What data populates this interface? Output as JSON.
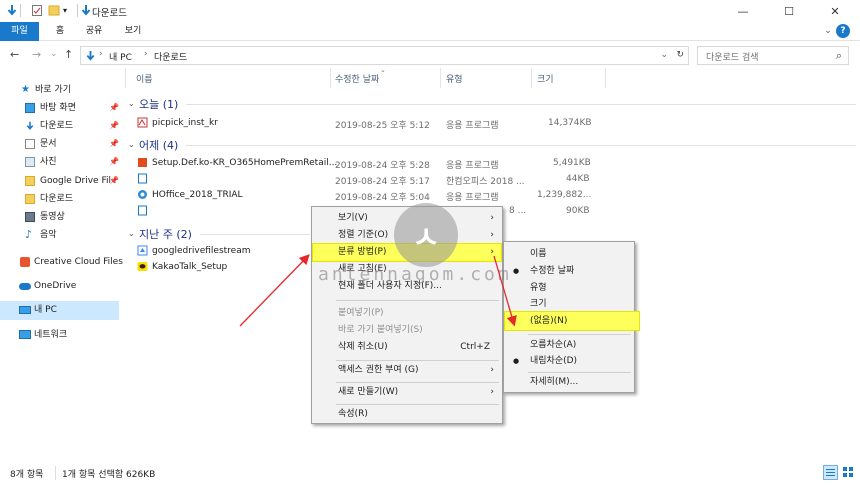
{
  "window": {
    "title": "다운로드",
    "minimize": "—",
    "maximize": "☐",
    "close": "✕"
  },
  "ribbon": {
    "tabs": [
      "파일",
      "홈",
      "공유",
      "보기"
    ],
    "expand": "⌄",
    "help": "?"
  },
  "address": {
    "nav_back": "←",
    "nav_forward": "→",
    "nav_recent": "⌄",
    "nav_up": "↑",
    "path": [
      "내 PC",
      "다운로드"
    ],
    "dropdown": "⌄",
    "refresh": "↻",
    "search_placeholder": "다운로드 검색",
    "search_icon": "⌕"
  },
  "sidebar": {
    "items": [
      {
        "label": "바로 가기",
        "icon": "star-icon",
        "pinned": false
      },
      {
        "label": "바탕 화면",
        "icon": "desktop-icon",
        "pinned": true
      },
      {
        "label": "다운로드",
        "icon": "download-icon",
        "pinned": true
      },
      {
        "label": "문서",
        "icon": "document-icon",
        "pinned": true
      },
      {
        "label": "사진",
        "icon": "pictures-icon",
        "pinned": true
      },
      {
        "label": "Google Drive Fil",
        "icon": "folder-icon",
        "pinned": true
      },
      {
        "label": "다운로드",
        "icon": "folder-icon",
        "pinned": false
      },
      {
        "label": "동영상",
        "icon": "video-icon",
        "pinned": false
      },
      {
        "label": "음악",
        "icon": "music-icon",
        "pinned": false
      },
      {
        "label": "Creative Cloud Files",
        "icon": "creative-cloud-icon",
        "pinned": false
      },
      {
        "label": "OneDrive",
        "icon": "onedrive-icon",
        "pinned": false
      },
      {
        "label": "내 PC",
        "icon": "pc-icon",
        "pinned": false
      },
      {
        "label": "네트워크",
        "icon": "network-icon",
        "pinned": false
      }
    ]
  },
  "columns": {
    "name": "이름",
    "date": "수정한 날짜",
    "type": "유형",
    "size": "크기"
  },
  "groups": [
    {
      "label": "오늘 (1)",
      "files": [
        {
          "name": "picpick_inst_kr",
          "date": "2019-08-25 오후 5:12",
          "type": "응용 프로그램",
          "size": "14,374KB"
        }
      ]
    },
    {
      "label": "어제 (4)",
      "files": [
        {
          "name": "Setup.Def.ko-KR_O365HomePremRetail...",
          "date": "2019-08-24 오후 5:28",
          "type": "응용 프로그램",
          "size": "5,491KB"
        },
        {
          "name": "",
          "date": "2019-08-24 오후 5:17",
          "type": "한컴오피스 2018 ...",
          "size": "44KB"
        },
        {
          "name": "HOffice_2018_TRIAL",
          "date": "2019-08-24 오후 5:04",
          "type": "응용 프로그램",
          "size": "1,239,882..."
        },
        {
          "name": "",
          "date": "",
          "type": "8 ...",
          "size": "90KB"
        }
      ]
    },
    {
      "label": "지난 주 (2)",
      "files": [
        {
          "name": "googledrivefilestream",
          "date": "",
          "type": "",
          "size": ""
        },
        {
          "name": "KakaoTalk_Setup",
          "date": "",
          "type": "",
          "size": ""
        }
      ]
    }
  ],
  "context_menu": {
    "items": [
      {
        "label": "보기(V)",
        "submenu": true
      },
      {
        "label": "정렬 기준(O)",
        "submenu": true
      },
      {
        "label": "분류 방법(P)",
        "submenu": true,
        "highlight": true
      },
      {
        "label": "새로 고침(E)"
      },
      {
        "label": "현재 폴더 사용자 지정(F)..."
      },
      {
        "label": "붙여넣기(P)",
        "disabled": true
      },
      {
        "label": "바로 가기 붙여넣기(S)",
        "disabled": true
      },
      {
        "label": "삭제 취소(U)",
        "shortcut": "Ctrl+Z"
      },
      {
        "label": "액세스 권한 부여 (G)",
        "submenu": true
      },
      {
        "label": "새로 만들기(W)",
        "submenu": true
      },
      {
        "label": "속성(R)"
      }
    ],
    "submenu_arrow": "›"
  },
  "submenu": {
    "items": [
      {
        "label": "이름"
      },
      {
        "label": "수정한 날짜",
        "bullet": true
      },
      {
        "label": "유형"
      },
      {
        "label": "크기"
      },
      {
        "label": "(없음)(N)",
        "highlight": true
      },
      {
        "label": "오름차순(A)"
      },
      {
        "label": "내림차순(D)",
        "bullet": true
      },
      {
        "label": "자세히(M)..."
      }
    ],
    "bullet_glyph": "●"
  },
  "status": {
    "count": "8개 항목",
    "selection": "1개 항목 선택함 626KB"
  },
  "watermark": {
    "glyph": "ㅅ",
    "text": "antennagom.com"
  },
  "colors": {
    "accent": "#1979ca",
    "highlight": "#fdff5a",
    "annotation": "#e8262c",
    "group_header": "#1e3287"
  }
}
